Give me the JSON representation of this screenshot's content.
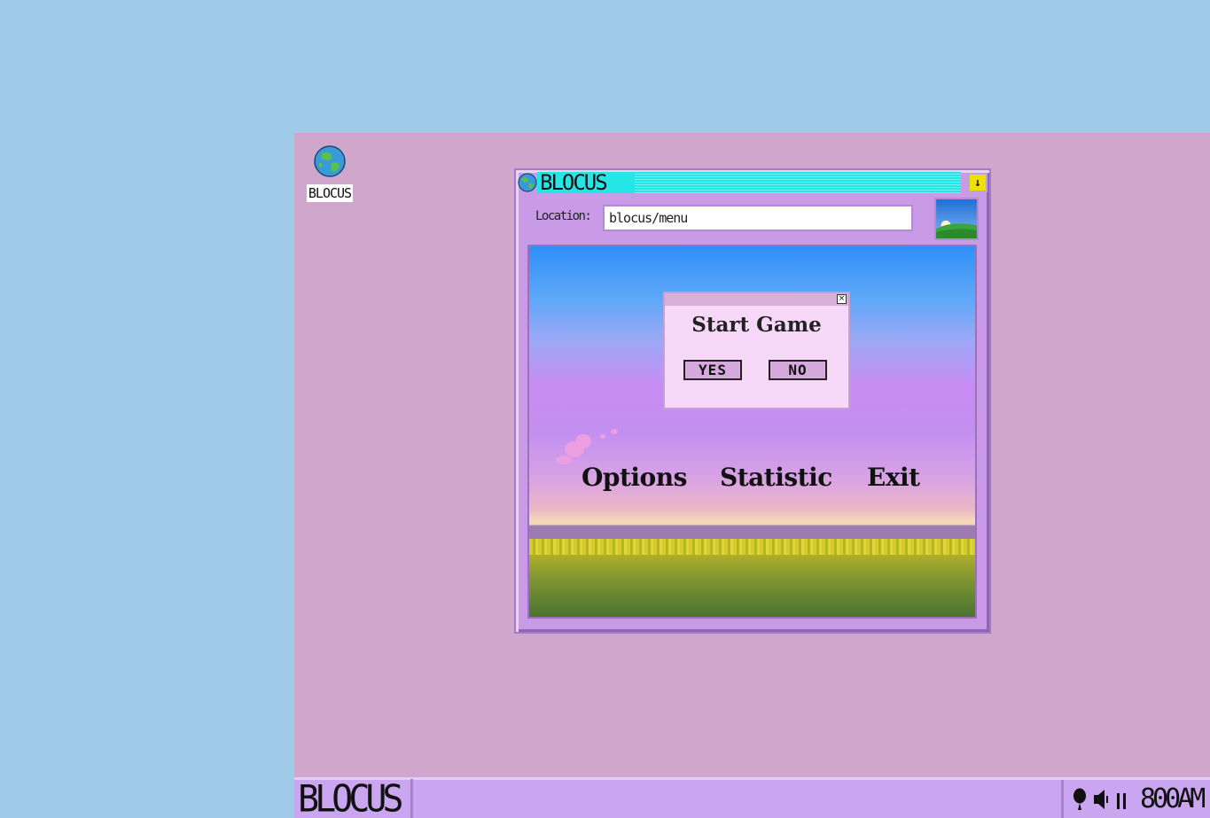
{
  "desktop": {
    "icon_label": "BLOCUS"
  },
  "window": {
    "title": "BLOCUS",
    "location_label": "Location:",
    "location_value": "blocus/menu",
    "minimize_glyph": "↓"
  },
  "game": {
    "menu": [
      "Options",
      "Statistic",
      "Exit"
    ],
    "dialog": {
      "close_glyph": "×",
      "title": "Start Game",
      "yes_label": "YES",
      "no_label": "NO"
    }
  },
  "taskbar": {
    "start_label": "BLOCUS",
    "clock": "800AM",
    "tray_icons": [
      "balloon-icon",
      "speaker-icon",
      "signal-icon"
    ]
  },
  "colors": {
    "sky_top": "#2f8ff8",
    "titlebar_accent": "#24e6e6",
    "desktop": "#cfa7cc",
    "taskbar": "#cba6f0"
  }
}
